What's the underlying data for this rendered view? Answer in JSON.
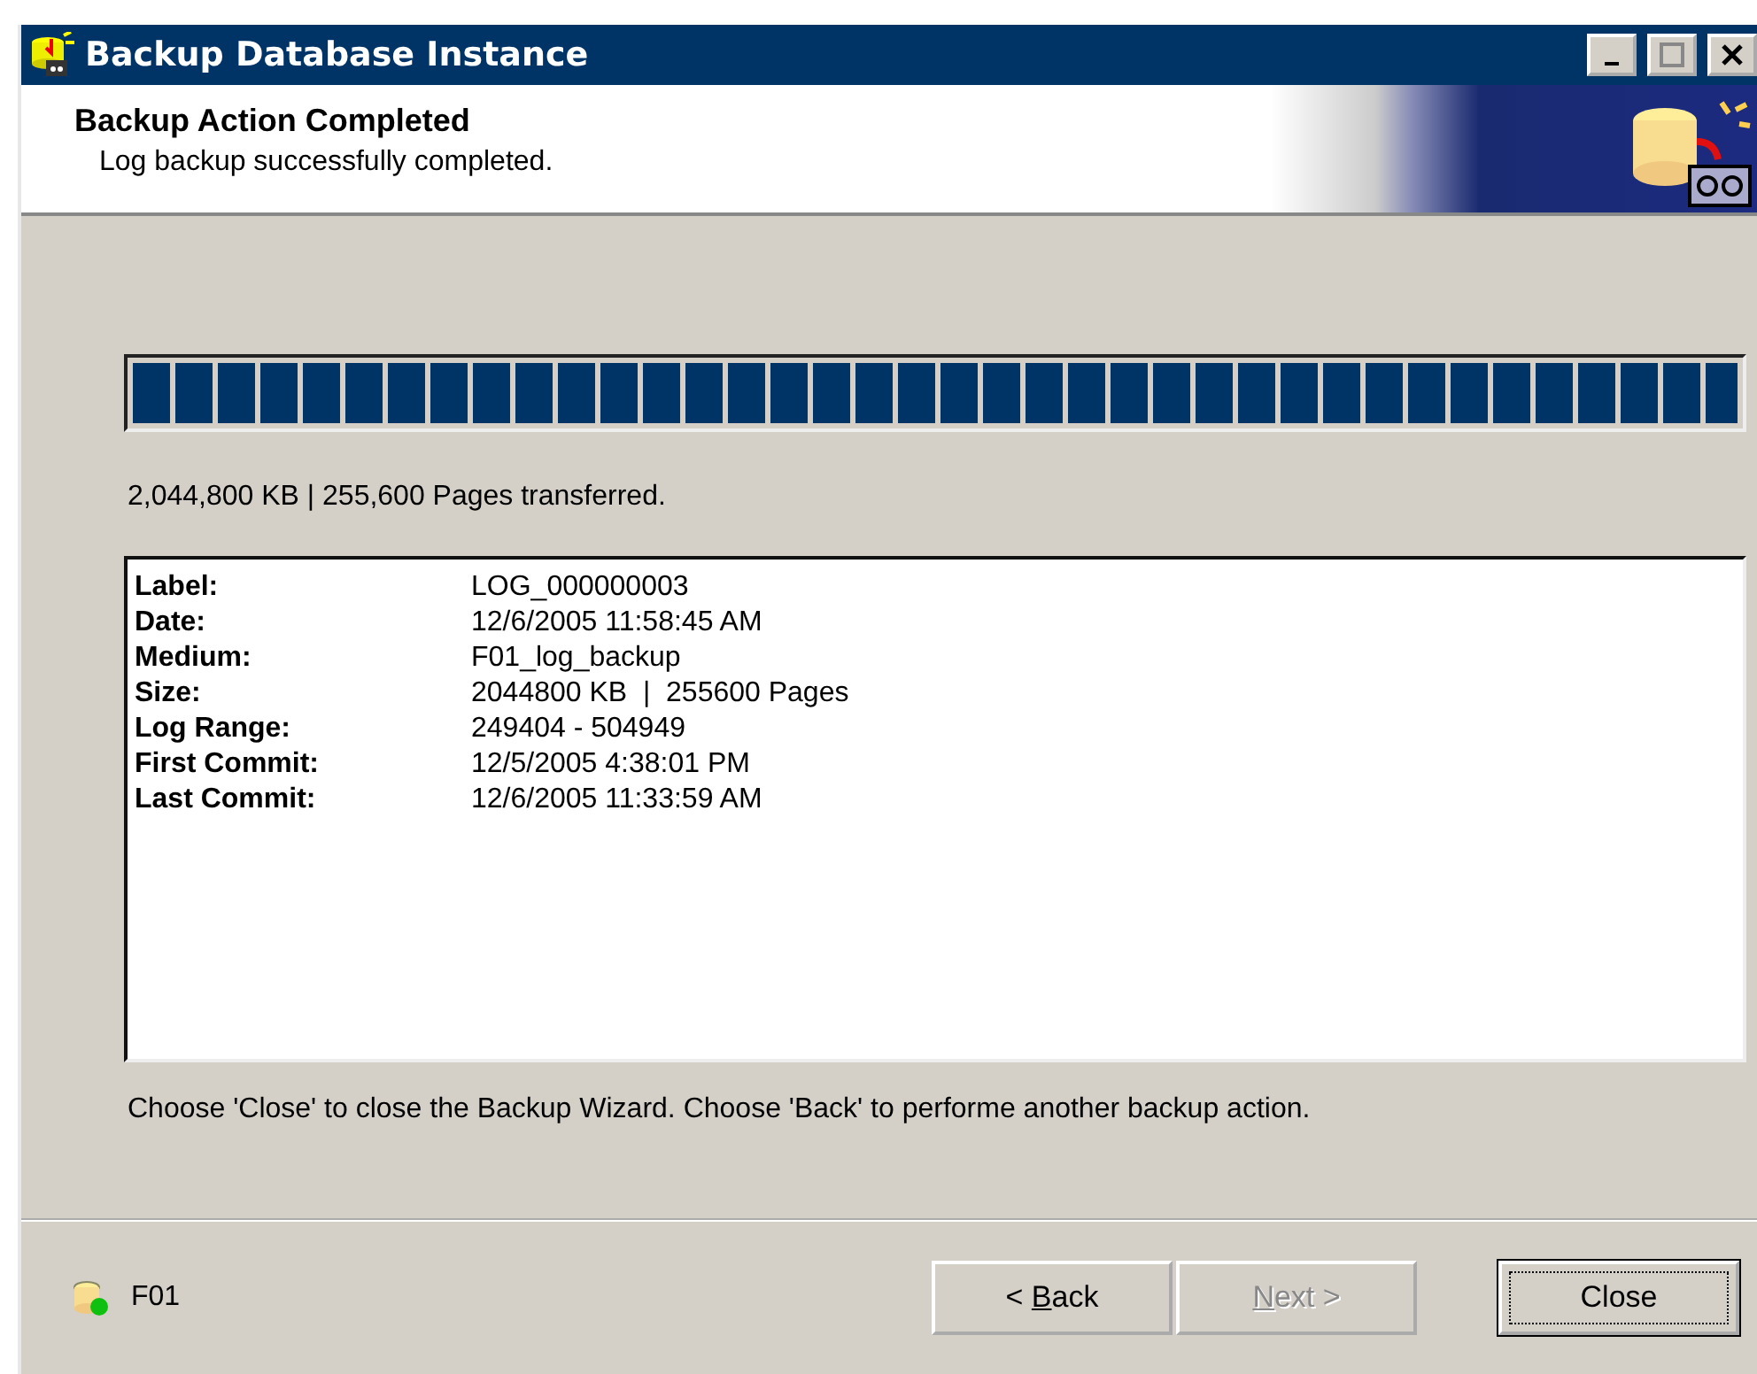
{
  "window": {
    "title": "Backup Database Instance"
  },
  "header": {
    "title": "Backup Action Completed",
    "subtitle": "Log backup successfully completed."
  },
  "progress": {
    "level": 1
  },
  "transfer_status": "2,044,800 KB | 255,600 Pages transferred.",
  "details": [
    {
      "label": "Label:",
      "value": "LOG_000000003"
    },
    {
      "label": "Date:",
      "value": "12/6/2005 11:58:45 AM"
    },
    {
      "label": "Medium:",
      "value": "F01_log_backup"
    },
    {
      "label": "Size:",
      "value": "2044800 KB  |  255600 Pages"
    },
    {
      "label": "Log Range:",
      "value": "249404 - 504949"
    },
    {
      "label": "First Commit:",
      "value": "12/5/2005 4:38:01 PM"
    },
    {
      "label": "Last Commit:",
      "value": "12/6/2005 11:33:59 AM"
    }
  ],
  "hint": "Choose 'Close' to close the Backup Wizard. Choose 'Back' to performe another backup action.",
  "status": {
    "instance": "F01"
  },
  "buttons": [
    {
      "before": "< ",
      "key": "B",
      "after": "ack",
      "disabled": false,
      "selected": false
    },
    {
      "key": "N",
      "after": "ext >",
      "disabled": true,
      "selected": false
    },
    {
      "after": "Close",
      "disabled": false,
      "selected": true
    }
  ]
}
